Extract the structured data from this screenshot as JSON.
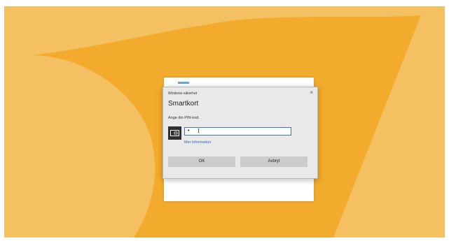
{
  "colors": {
    "wallpaper_base": "#f2ab2c",
    "wallpaper_light": "#f4c062",
    "dialog_bg": "#e9e9e9",
    "button_bg": "#cccccc",
    "link": "#2a68b5",
    "input_border": "#3c78c8"
  },
  "dialog": {
    "caption": "Windows-säkerhet",
    "close_icon": "×",
    "title": "Smartkort",
    "prompt": "Ange din PIN-kod.",
    "card_icon": "smart-card-icon",
    "pin_value": "•",
    "more_info": "Mer information",
    "ok_label": "OK",
    "cancel_label": "Avbryt"
  }
}
